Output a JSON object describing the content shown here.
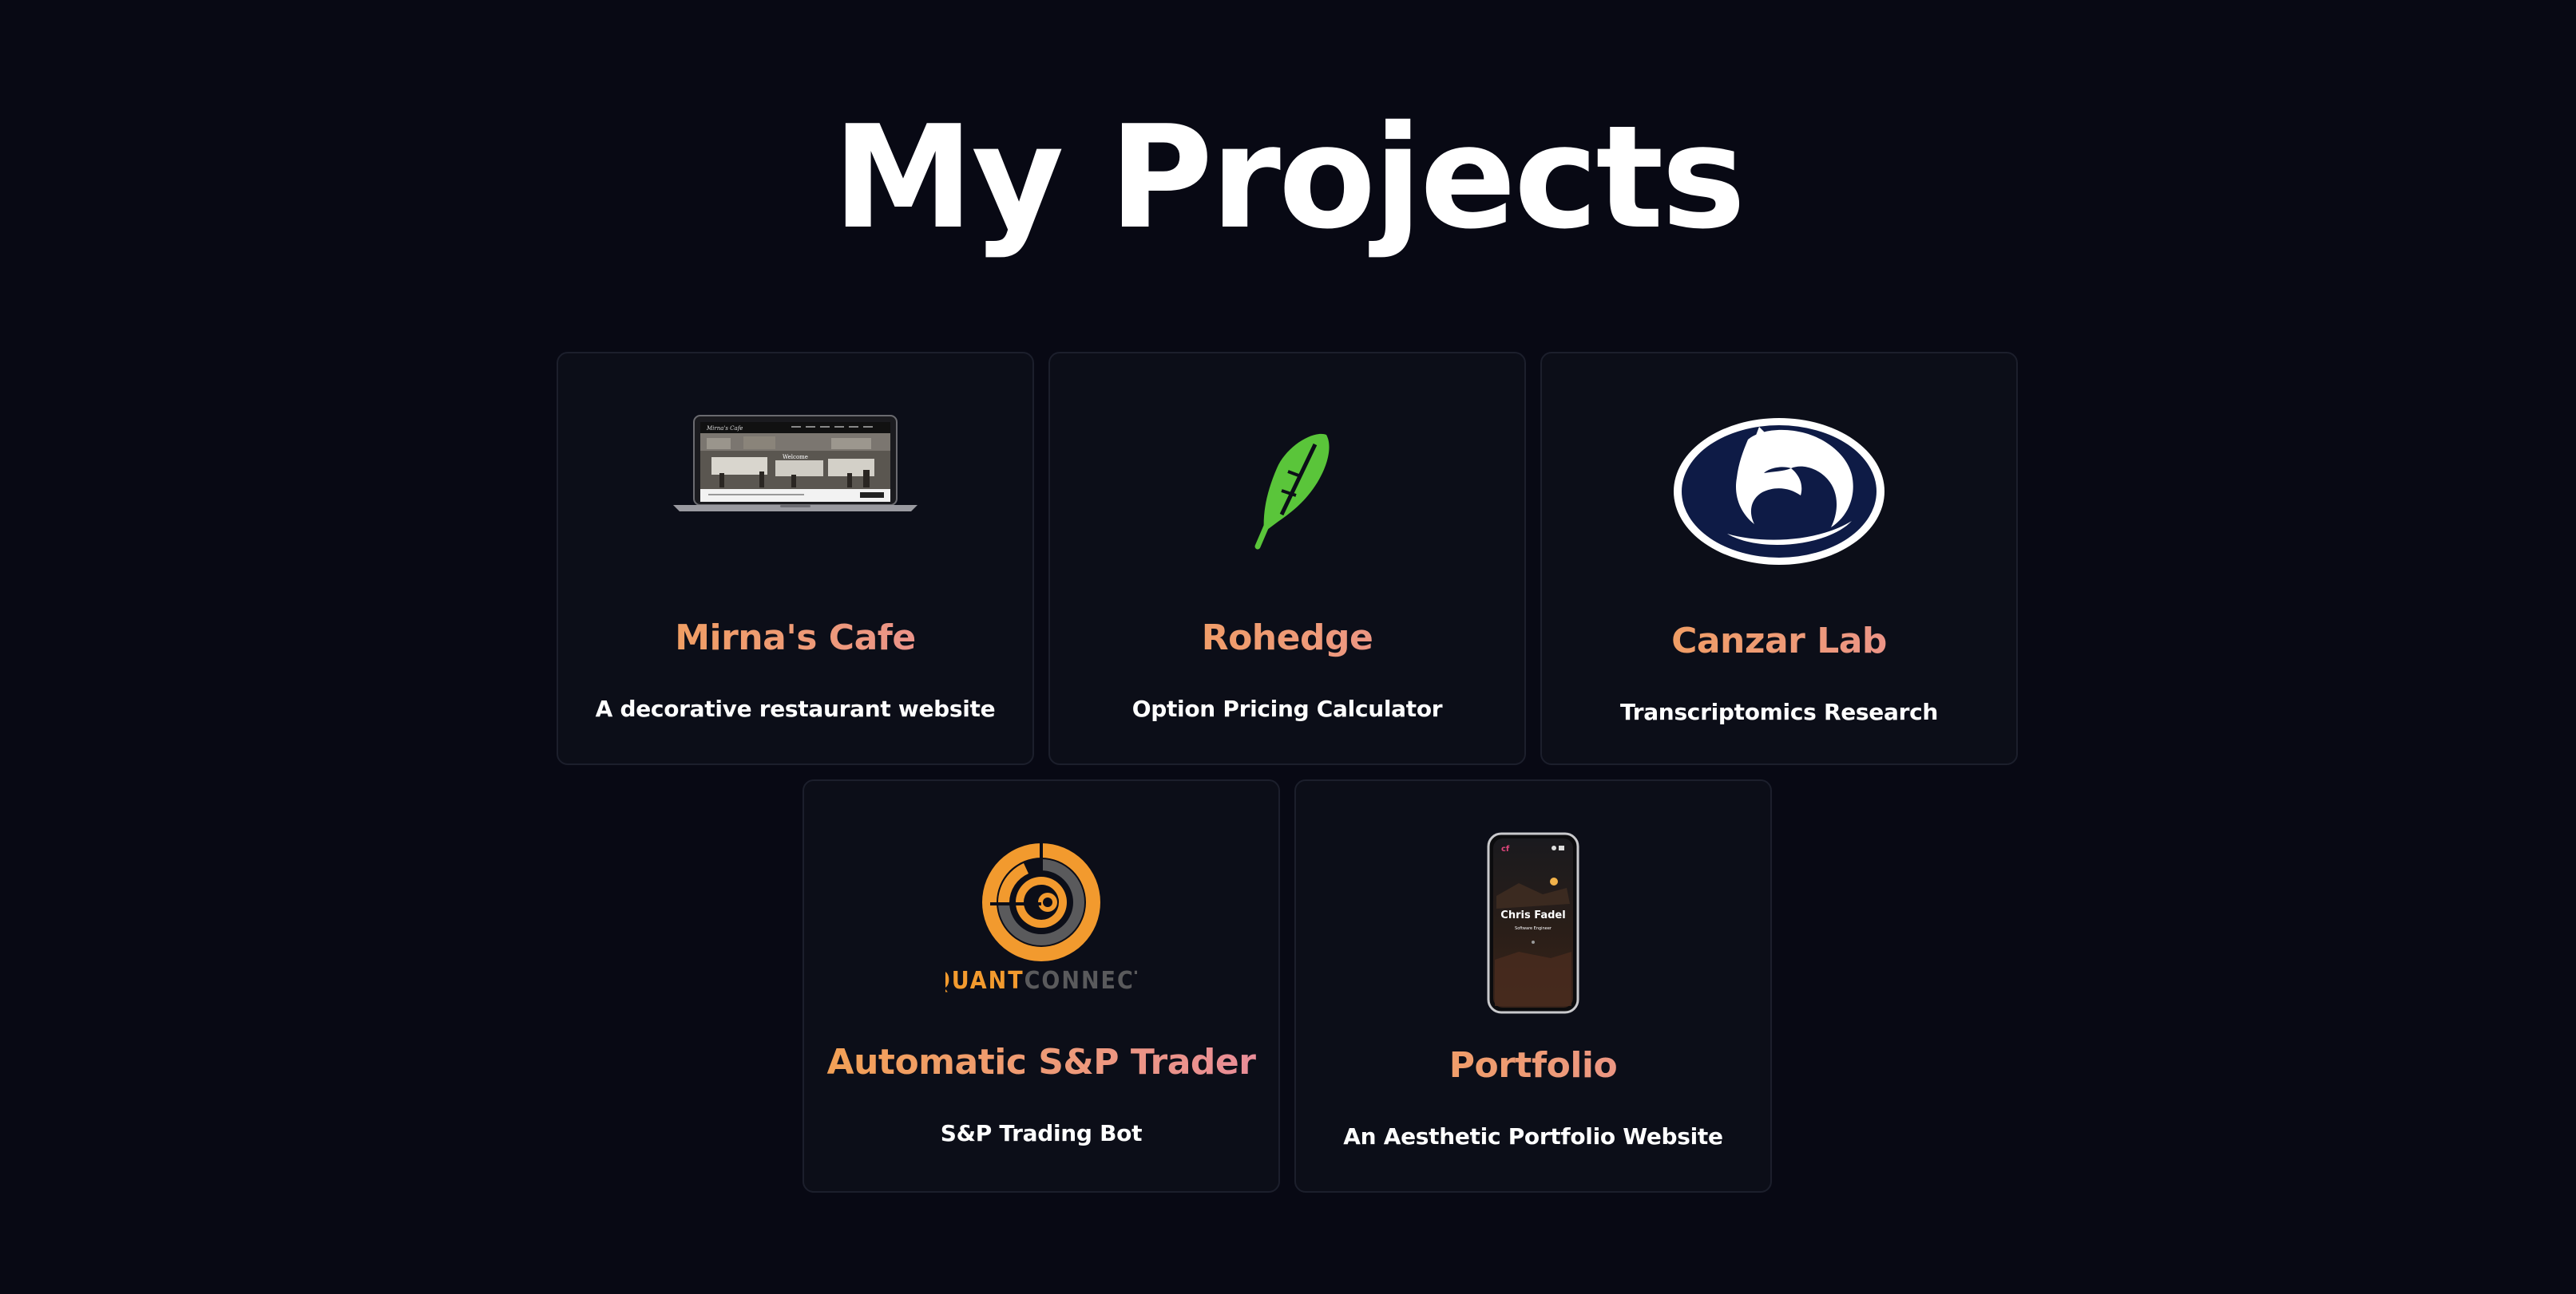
{
  "page": {
    "title": "My Projects",
    "background": "#080914"
  },
  "colors": {
    "card_bg": "#0c0e18",
    "card_border": "#1c1f2c",
    "title_gradient": [
      "#f3a152",
      "#e88b9c"
    ],
    "description": "#ffffff",
    "robinhood_green": "#5ac53a",
    "penn_state_navy": "#0e1b46",
    "quantconnect_orange": "#f29a2e",
    "quantconnect_gray": "#5a5a5c"
  },
  "projects": [
    {
      "title": "Mirna's Cafe",
      "description": "A decorative restaurant website",
      "image": "laptop-website-mockup",
      "mockup_logo": "Mirna's Cafe"
    },
    {
      "title": "Rohedge",
      "description": "Option Pricing Calculator",
      "image": "feather-icon"
    },
    {
      "title": "Canzar Lab",
      "description": "Transcriptomics Research",
      "image": "nittany-lion-logo"
    },
    {
      "title": "Automatic S&P Trader",
      "description": "S&P Trading Bot",
      "image": "quantconnect-logo",
      "logo_text_a": "QUANT",
      "logo_text_b": "CONNECT"
    },
    {
      "title": "Portfolio",
      "description": "An Aesthetic Portfolio Website",
      "image": "phone-website-mockup",
      "phone_name": "Chris Fadel",
      "phone_subtitle": "Software Engineer",
      "phone_logo": "cf"
    }
  ]
}
